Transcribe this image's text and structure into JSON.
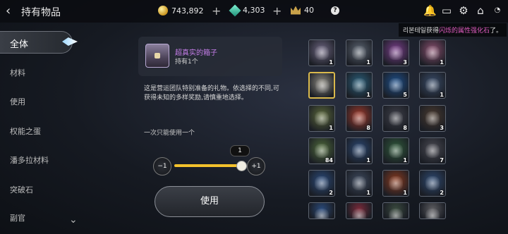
{
  "header": {
    "title": "持有物品",
    "gold": "743,892",
    "gems": "4,303",
    "crowns": "40",
    "help": "?"
  },
  "notice": {
    "prefix": "리본테일获得",
    "highlight": "闪烁的属性强化石",
    "suffix": "了。"
  },
  "sidebar": {
    "items": [
      {
        "label": "全体",
        "active": true
      },
      {
        "label": "材料"
      },
      {
        "label": "使用"
      },
      {
        "label": "权能之蛋"
      },
      {
        "label": "潘多拉材料"
      },
      {
        "label": "突破石"
      },
      {
        "label": "副官"
      }
    ]
  },
  "detail": {
    "name": "超真实的箱子",
    "owned": "持有1个",
    "description": "这是营运团队特别准备的礼物。依选择的不同,可获得未知的多样奖励,请慎重地选择。",
    "once": "一次只能使用一个",
    "quantity": "1",
    "minus": "−1",
    "plus": "+1",
    "use": "使用"
  },
  "inventory": [
    {
      "icon": "chest-icon",
      "count": "1",
      "color": "#6d6580",
      "selected": false
    },
    {
      "icon": "chest-icon",
      "count": "1",
      "color": "#5b6470",
      "selected": false
    },
    {
      "icon": "event-orb-icon",
      "count": "3",
      "color": "#7a3e8a",
      "selected": false
    },
    {
      "icon": "pink-chest-icon",
      "count": "1",
      "color": "#8a4f6e",
      "selected": false
    },
    {
      "icon": "chest-icon",
      "count": "",
      "color": "#8d8a80",
      "selected": true
    },
    {
      "icon": "crystal-armor-icon",
      "count": "1",
      "color": "#2a5f7a",
      "selected": false
    },
    {
      "icon": "blue-claw-icon",
      "count": "5",
      "color": "#1d4f8a",
      "selected": false
    },
    {
      "icon": "torch-icon",
      "count": "1",
      "color": "#3a4d6a",
      "selected": false
    },
    {
      "icon": "ring-icon",
      "count": "1",
      "color": "#5d6a3a",
      "selected": false
    },
    {
      "icon": "red-orb-icon",
      "count": "8",
      "color": "#a33a2a",
      "selected": false
    },
    {
      "icon": "dark-beast-icon",
      "count": "8",
      "color": "#3e3f48",
      "selected": false
    },
    {
      "icon": "dragon-icon",
      "count": "3",
      "color": "#4a3a2e",
      "selected": false
    },
    {
      "icon": "rice-ball-icon",
      "count": "84",
      "color": "#4f6a3a",
      "selected": false
    },
    {
      "icon": "blue-armor-icon",
      "count": "1",
      "color": "#2a4670",
      "selected": false
    },
    {
      "icon": "horn-icon",
      "count": "1",
      "color": "#2f5a3a",
      "selected": false
    },
    {
      "icon": "black-sphere-icon",
      "count": "7",
      "color": "#4a4a52",
      "selected": false
    },
    {
      "icon": "blue-sword-icon",
      "count": "2",
      "color": "#2a4a7a",
      "selected": false
    },
    {
      "icon": "silver-sword-icon",
      "count": "1",
      "color": "#3e4a5e",
      "selected": false
    },
    {
      "icon": "lava-orb-icon",
      "count": "1",
      "color": "#8a3a1e",
      "selected": false
    },
    {
      "icon": "knight-helm-icon",
      "count": "2",
      "color": "#2e4a72",
      "selected": false
    },
    {
      "icon": "blue-staff-icon",
      "count": "",
      "color": "#2a4a7a",
      "selected": false
    },
    {
      "icon": "red-emblem-icon",
      "count": "",
      "color": "#7a2a3a",
      "selected": false
    },
    {
      "icon": "beast-armor-icon",
      "count": "",
      "color": "#3a4a3e",
      "selected": false
    },
    {
      "icon": "scroll-icon",
      "count": "",
      "color": "#5e5e62",
      "selected": false
    }
  ]
}
